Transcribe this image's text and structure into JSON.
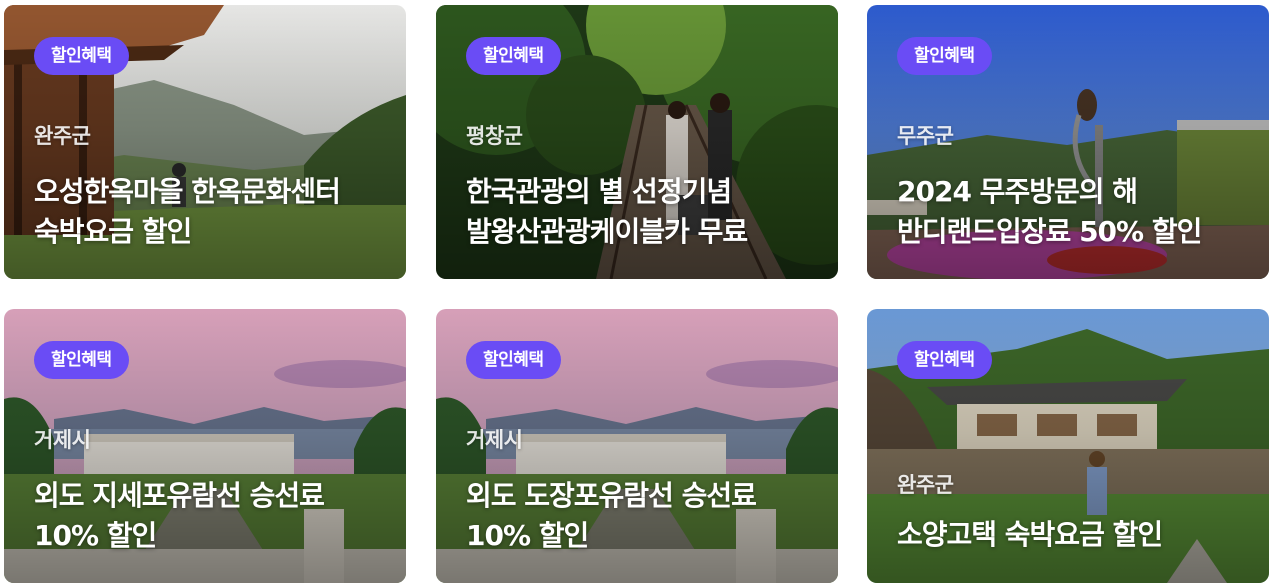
{
  "cards": [
    {
      "badge": "할인혜택",
      "region": "완주군",
      "title_line1": "오성한옥마을 한옥문화센터",
      "title_line2": "숙박요금 할인"
    },
    {
      "badge": "할인혜택",
      "region": "평창군",
      "title_line1": "한국관광의 별 선정기념",
      "title_line2": "발왕산관광케이블카 무료"
    },
    {
      "badge": "할인혜택",
      "region": "무주군",
      "title_line1": "2024 무주방문의 해",
      "title_line2": "반디랜드입장료 50% 할인"
    },
    {
      "badge": "할인혜택",
      "region": "거제시",
      "title_line1": "외도 지세포유람선 승선료",
      "title_line2": "10% 할인"
    },
    {
      "badge": "할인혜택",
      "region": "거제시",
      "title_line1": "외도 도장포유람선 승선료",
      "title_line2": "10% 할인"
    },
    {
      "badge": "할인혜택",
      "region": "완주군",
      "title_line1": "소양고택 숙박요금 할인",
      "title_line2": ""
    }
  ],
  "colors": {
    "badge": "#6a4cf5",
    "text": "#ffffff"
  }
}
